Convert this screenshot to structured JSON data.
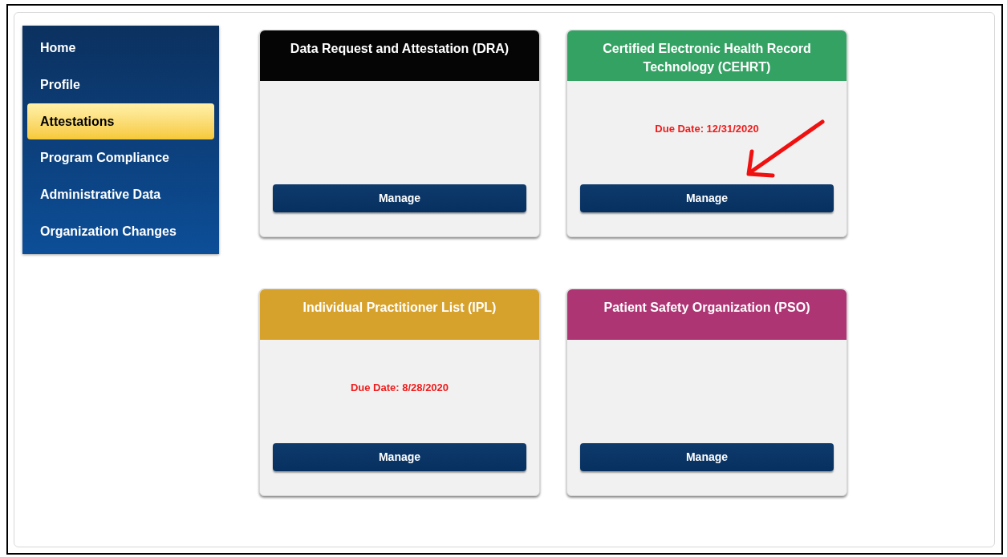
{
  "sidebar": {
    "items": [
      {
        "label": "Home",
        "selected": false
      },
      {
        "label": "Profile",
        "selected": false
      },
      {
        "label": "Attestations",
        "selected": true
      },
      {
        "label": "Program Compliance",
        "selected": false
      },
      {
        "label": "Administrative Data",
        "selected": false
      },
      {
        "label": "Organization Changes",
        "selected": false
      }
    ]
  },
  "cards": [
    {
      "title": "Data Request and Attestation (DRA)",
      "color": "#050505",
      "button": "Manage",
      "pointer_arrow": false
    },
    {
      "title": "Certified Electronic Health Record Technology (CEHRT)",
      "color": "#34a263",
      "due_date": "Due Date: 12/31/2020",
      "button": "Manage",
      "pointer_arrow": true
    },
    {
      "title": "Individual Practitioner List (IPL)",
      "color": "#d7a22c",
      "due_date": "Due Date: 8/28/2020",
      "button": "Manage",
      "pointer_arrow": false
    },
    {
      "title": "Patient Safety Organization (PSO)",
      "color": "#ad3574",
      "button": "Manage",
      "pointer_arrow": false
    }
  ]
}
